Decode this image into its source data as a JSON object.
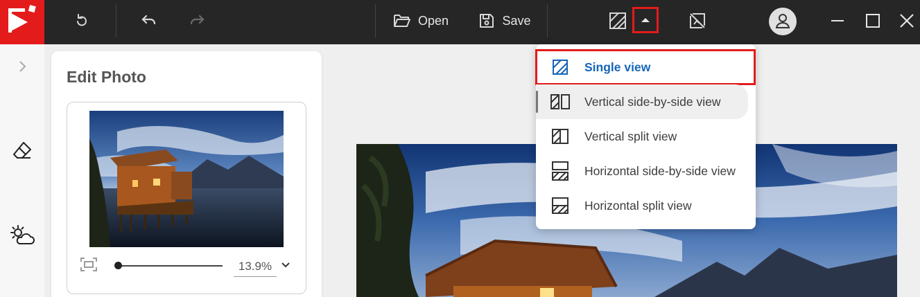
{
  "toolbar": {
    "open_label": "Open",
    "save_label": "Save",
    "icons": [
      "app-logo",
      "refresh-icon",
      "undo-icon",
      "redo-icon",
      "folder-open-icon",
      "save-icon",
      "single-view-icon",
      "caret-up-icon",
      "compare-off-icon",
      "account-icon",
      "minimize-icon",
      "maximize-icon",
      "close-icon"
    ]
  },
  "panel": {
    "title": "Edit Photo",
    "zoom_value": "13.9%",
    "zoom_fraction": 0.0
  },
  "view_menu": {
    "items": [
      {
        "label": "Single view",
        "icon": "single-view-icon",
        "selected": true
      },
      {
        "label": "Vertical side-by-side view",
        "icon": "vertical-side-by-side-icon"
      },
      {
        "label": "Vertical split view",
        "icon": "vertical-split-icon"
      },
      {
        "label": "Horizontal side-by-side view",
        "icon": "horizontal-side-by-side-icon"
      },
      {
        "label": "Horizontal split view",
        "icon": "horizontal-split-icon"
      }
    ]
  },
  "colors": {
    "topbar": "#262626",
    "brand_red": "#e41b1b",
    "selected_blue": "#1565b8"
  }
}
